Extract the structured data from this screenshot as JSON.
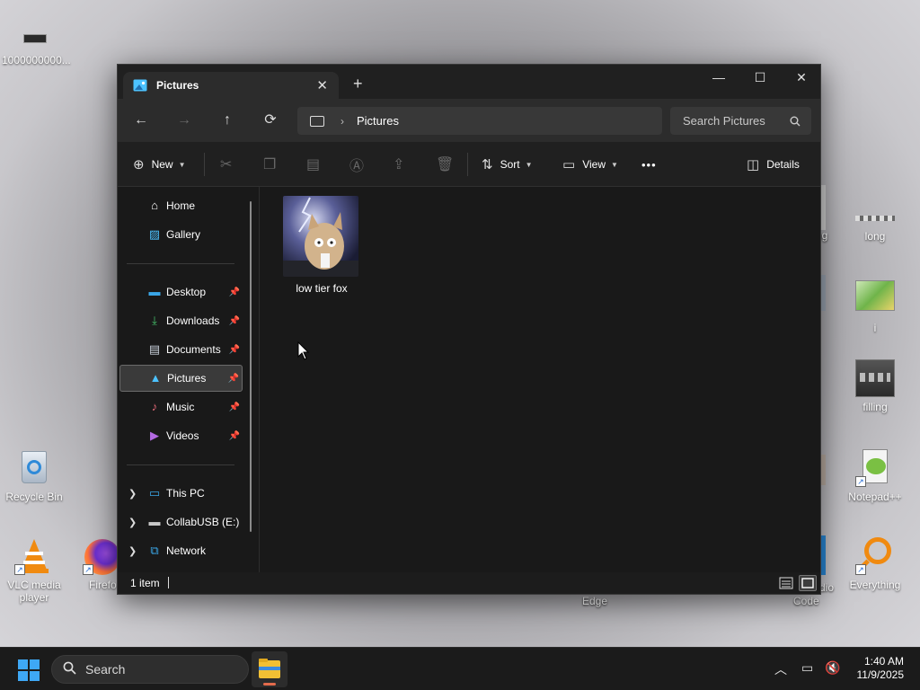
{
  "desktop": {
    "icons": [
      {
        "label": "1000000000...",
        "icon": "image-file-icon"
      },
      {
        "label": "Recycle Bin",
        "icon": "recycle-bin-icon"
      },
      {
        "label": "VLC media player",
        "icon": "vlc-icon"
      },
      {
        "label": "Firefo",
        "icon": "firefox-icon"
      },
      {
        "label": "long",
        "icon": "image-file-icon"
      },
      {
        "label": "i",
        "icon": "image-file-icon"
      },
      {
        "label": "filling",
        "icon": "image-file-icon"
      },
      {
        "label": "Notepad++",
        "icon": "notepad-plus-plus-icon"
      },
      {
        "label": "Everything",
        "icon": "everything-search-icon"
      },
      {
        "label": "ng",
        "icon": "partial"
      },
      {
        "label": "Edge",
        "icon": "edge-icon"
      },
      {
        "label": "dio",
        "icon": "partial"
      },
      {
        "label": "Code",
        "icon": "partial"
      }
    ]
  },
  "window": {
    "tab_title": "Pictures",
    "tab_close": "✕",
    "new_tab": "+",
    "controls": {
      "minimize": "—",
      "maximize": "☐",
      "close": "✕"
    },
    "nav": {
      "back": "←",
      "forward": "→",
      "up": "↑",
      "refresh": "⟳"
    },
    "address": {
      "separator": "›",
      "crumb": "Pictures"
    },
    "search_placeholder": "Search Pictures",
    "commands": {
      "new_label": "New",
      "sort_label": "Sort",
      "view_label": "View",
      "more": "•••",
      "details_label": "Details"
    },
    "sidebar": {
      "items": [
        {
          "label": "Home",
          "icon": "home-icon",
          "pinned": false
        },
        {
          "label": "Gallery",
          "icon": "gallery-icon",
          "pinned": false
        },
        {
          "label": "Desktop",
          "icon": "desktop-folder-icon",
          "pinned": true
        },
        {
          "label": "Downloads",
          "icon": "downloads-icon",
          "pinned": true
        },
        {
          "label": "Documents",
          "icon": "documents-icon",
          "pinned": true
        },
        {
          "label": "Pictures",
          "icon": "pictures-icon",
          "pinned": true,
          "selected": true
        },
        {
          "label": "Music",
          "icon": "music-icon",
          "pinned": true
        },
        {
          "label": "Videos",
          "icon": "videos-icon",
          "pinned": true
        },
        {
          "label": "This PC",
          "icon": "this-pc-icon",
          "expandable": true
        },
        {
          "label": "CollabUSB (E:)",
          "icon": "usb-drive-icon",
          "expandable": true
        },
        {
          "label": "Network",
          "icon": "network-icon",
          "expandable": true
        }
      ]
    },
    "files": [
      {
        "name": "low tier fox",
        "type": "image"
      }
    ],
    "status": {
      "item_count": "1 item"
    }
  },
  "taskbar": {
    "search_label": "Search",
    "time": "1:40 AM",
    "date": "11/9/2025"
  },
  "colors": {
    "window_bg": "#191919",
    "accent": "#4cc2ff",
    "taskbar_bg": "#1b1b1b"
  }
}
